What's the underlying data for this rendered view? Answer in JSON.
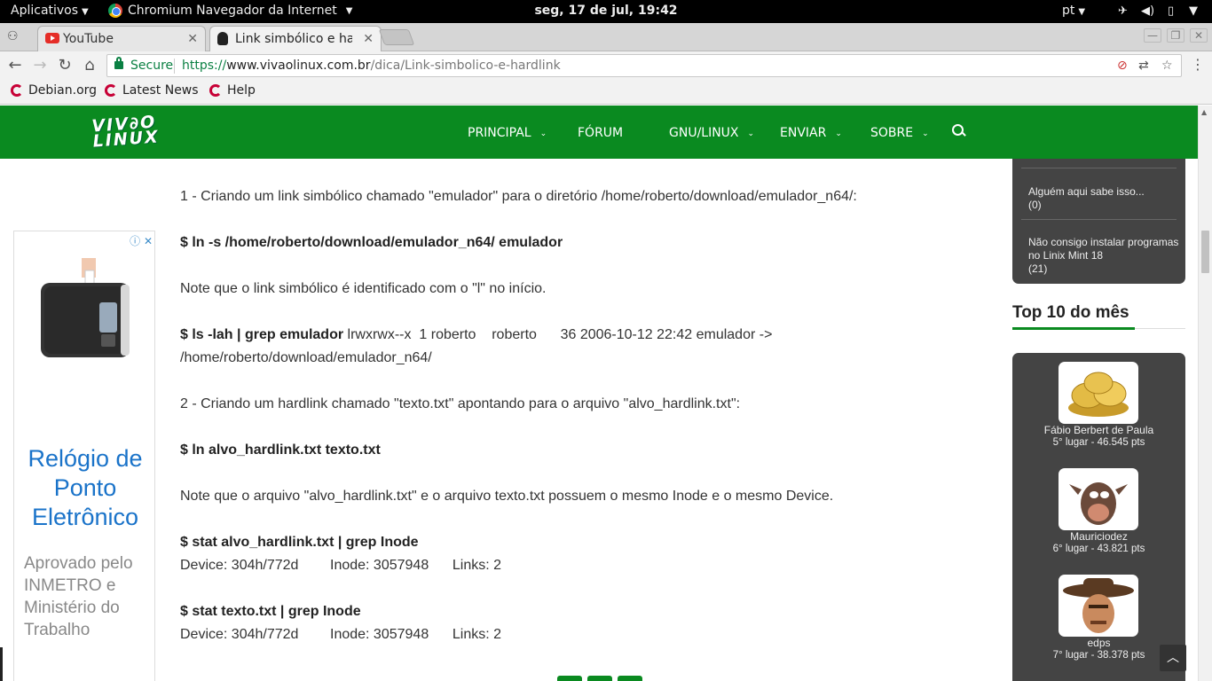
{
  "system": {
    "apps_menu": "Aplicativos",
    "app_name": "Chromium Navegador da Internet",
    "clock": "seg, 17 de jul, 19:42",
    "language": "pt"
  },
  "tabs": [
    {
      "title": "YouTube",
      "active": false
    },
    {
      "title": "Link simbólico e hard",
      "active": true
    }
  ],
  "toolbar": {
    "secure_label": "Secure",
    "url_scheme": "https://",
    "url_host": "www.vivaolinux.com.br",
    "url_path": "/dica/Link-simbolico-e-hardlink"
  },
  "bookmarks": [
    "Debian.org",
    "Latest News",
    "Help"
  ],
  "site": {
    "logo_line1": "VIV∂O",
    "logo_line2": "LINUX",
    "nav": [
      "PRINCIPAL",
      "FÓRUM",
      "GNU/LINUX",
      "ENVIAR",
      "SOBRE"
    ],
    "brand_color": "#0a8a20"
  },
  "article": {
    "p1": "1 - Criando um link simbólico chamado \"emulador\" para o diretório /home/roberto/download/emulador_n64/:",
    "cmd1": "$ ln -s /home/roberto/download/emulador_n64/ emulador",
    "p2": "Note que o link simbólico é identificado com o \"l\" no início.",
    "cmd2": "$ ls -lah | grep emulador",
    "out2a": " lrwxrwx--x  1 roberto    roberto      36 2006-10-12 22:42 emulador ->",
    "out2b": "/home/roberto/download/emulador_n64/",
    "p3": "2 - Criando um hardlink chamado \"texto.txt\" apontando para o arquivo \"alvo_hardlink.txt\":",
    "cmd3": "$ ln alvo_hardlink.txt texto.txt",
    "p4": "Note que o arquivo \"alvo_hardlink.txt\" e o arquivo texto.txt possuem o mesmo Inode e o mesmo Device.",
    "cmd4": "$ stat alvo_hardlink.txt | grep Inode",
    "out4": "Device: 304h/772d        Inode: 3057948      Links: 2",
    "cmd5": "$ stat texto.txt | grep Inode",
    "out5": "Device: 304h/772d        Inode: 3057948      Links: 2"
  },
  "ad": {
    "title": "Relógio de Ponto Eletrônico",
    "body": "Aprovado pelo INMETRO e Ministério do Trabalho"
  },
  "sidebar": {
    "forum_items": [
      {
        "title": "Alguém aqui sabe isso...",
        "count": "(0)"
      },
      {
        "title": "Não consigo instalar programas no Linix Mint 18",
        "count": "(21)"
      }
    ],
    "top10_title": "Top 10 do mês",
    "ranking": [
      {
        "name": "Fábio Berbert de Paula",
        "points": "5° lugar - 46.545 pts",
        "avatar": "coins-icon"
      },
      {
        "name": "Mauriciodez",
        "points": "6° lugar - 43.821 pts",
        "avatar": "tasmanian-devil-icon"
      },
      {
        "name": "edps",
        "points": "7° lugar - 38.378 pts",
        "avatar": "cowboy-icon"
      }
    ]
  }
}
